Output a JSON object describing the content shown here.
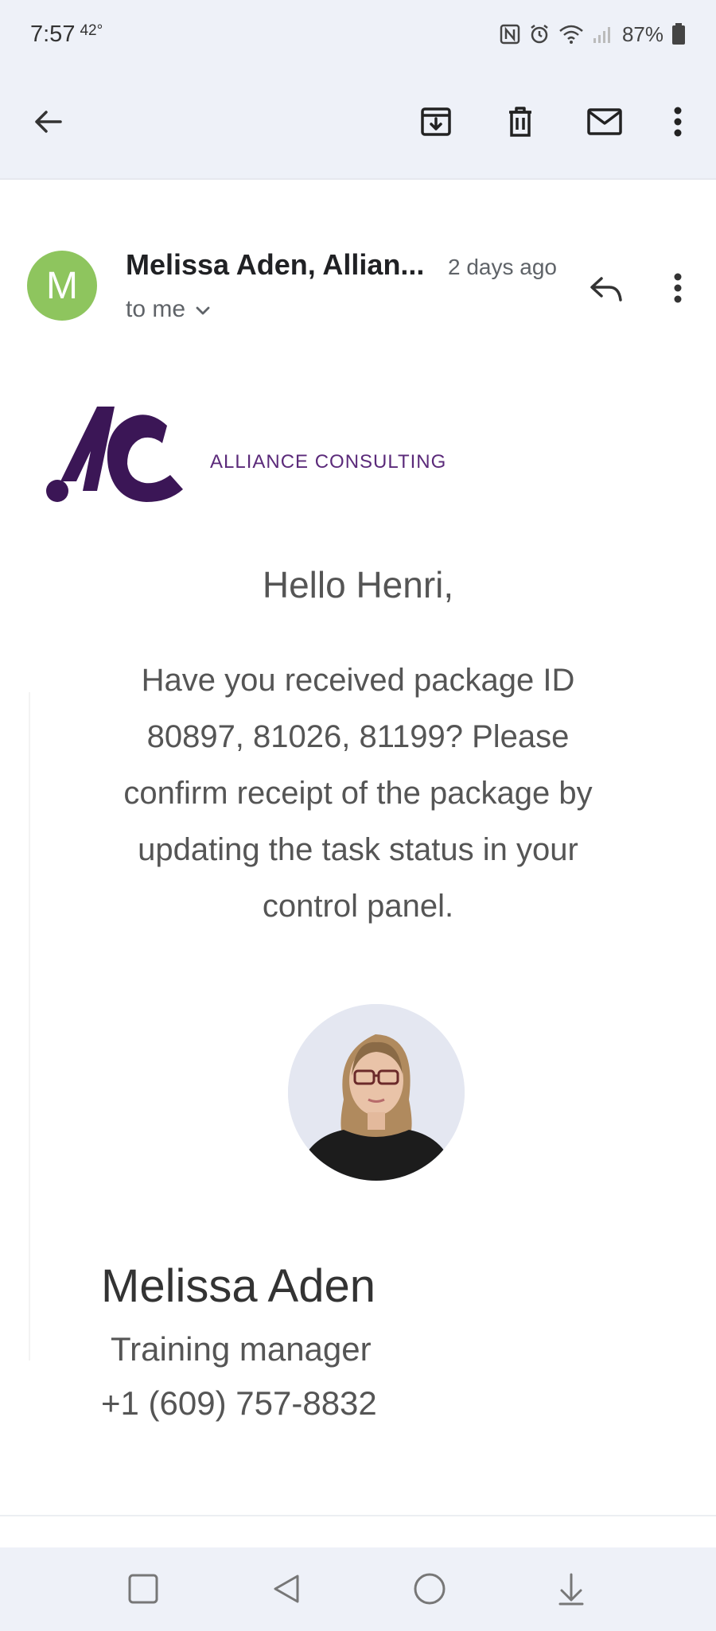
{
  "status_bar": {
    "time": "7:57",
    "temperature": "42°",
    "battery": "87%",
    "icons": [
      "nfc-icon",
      "alarm-icon",
      "wifi-icon",
      "signal-icon",
      "battery-icon"
    ]
  },
  "toolbar": {
    "icons": [
      "back-arrow-icon",
      "archive-icon",
      "delete-icon",
      "mark-unread-icon",
      "more-vert-icon"
    ]
  },
  "email": {
    "avatar_letter": "M",
    "avatar_color": "#8ec55e",
    "sender": "Melissa Aden, Allian...",
    "time": "2 days ago",
    "recipient": "to me",
    "logo_text": "ALLIANCE CONSULTING",
    "brand_color": "#3b1656",
    "greeting": "Hello Henri,",
    "body_lines": [
      "Have you received package ID",
      "80897, 81026, 81199? Please",
      "confirm receipt of the package by",
      "updating the task status in your",
      "control panel."
    ],
    "signature": {
      "name": "Melissa Aden",
      "title": "Training manager",
      "phone": "+1 (609) 757-8832"
    }
  },
  "nav_bar": {
    "icons": [
      "recent-apps-icon",
      "back-icon",
      "home-icon",
      "notifications-down-icon"
    ]
  }
}
